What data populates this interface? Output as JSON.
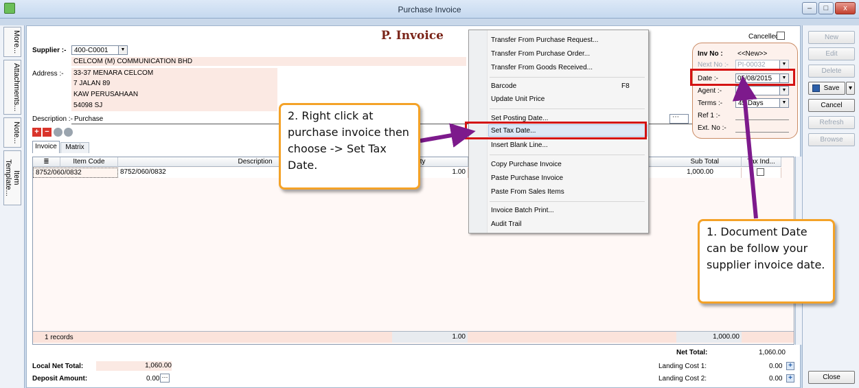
{
  "window": {
    "title": "Purchase Invoice",
    "minimize": "–",
    "maximize": "□",
    "close": "x"
  },
  "side_tabs": [
    "More...",
    "Attachments...",
    "Note...",
    "Item Template..."
  ],
  "header": {
    "heading": "P. Invoice",
    "cancelled_label": "Cancelled"
  },
  "supplier": {
    "label": "Supplier :-",
    "code": "400-C0001",
    "name": "CELCOM (M) COMMUNICATION BHD"
  },
  "address": {
    "label": "Address :-",
    "lines": [
      "33-37 MENARA CELCOM",
      "7 JALAN 89",
      "KAW PERUSAHAAN",
      "54098 SJ"
    ]
  },
  "description": {
    "label": "Description :-",
    "value": "Purchase"
  },
  "tabs": [
    "Invoice",
    "Matrix"
  ],
  "invoice_info": {
    "inv_no_label": "Inv No :",
    "inv_no": "<<New>>",
    "next_no_label": "Next No :-",
    "next_no": "PI-00032",
    "date_label": "Date :-",
    "date": "05/08/2015",
    "agent_label": "Agent :-",
    "agent": "----",
    "terms_label": "Terms :-",
    "terms": "45 Days",
    "ref1_label": "Ref 1 :-",
    "ext_no_label": "Ext. No :-"
  },
  "grid": {
    "headers": [
      "Item Code",
      "Description",
      "Qty",
      "Sub Total",
      "Tax Ind..."
    ],
    "row": {
      "item_code": "8752/060/0832",
      "description": "8752/060/0832",
      "qty": "1.00",
      "sub_total": "1,000.00"
    },
    "footer": {
      "records": "1 records",
      "qty": "1.00",
      "sub_total": "1,000.00"
    }
  },
  "totals": {
    "net_total_label": "Net Total:",
    "net_total": "1,060.00",
    "landing1_label": "Landing Cost 1:",
    "landing1": "0.00",
    "landing2_label": "Landing Cost 2:",
    "landing2": "0.00",
    "local_net_label": "Local Net Total:",
    "local_net": "1,060.00",
    "deposit_label": "Deposit Amount:",
    "deposit": "0.00"
  },
  "right_buttons": {
    "new": "New",
    "edit": "Edit",
    "delete": "Delete",
    "save": "Save",
    "cancel": "Cancel",
    "refresh": "Refresh",
    "browse": "Browse",
    "close": "Close"
  },
  "context_menu": {
    "items": [
      "Transfer From Purchase Request...",
      "Transfer From Purchase Order...",
      "Transfer From Goods Received...",
      "Barcode",
      "Update Unit Price",
      "Set Posting Date...",
      "Set Tax Date...",
      "Insert Blank Line...",
      "Copy Purchase Invoice",
      "Paste Purchase Invoice",
      "Paste From Sales Items",
      "Invoice Batch Print...",
      "Audit Trail"
    ],
    "barcode_shortcut": "F8"
  },
  "callouts": {
    "step2": "2. Right click at purchase invoice then choose -> Set Tax Date.",
    "step1": "1. Document Date can be follow your supplier invoice date."
  },
  "colors": {
    "highlight_red": "#d41212",
    "callout_border": "#f4a227",
    "arrow_purple": "#7d1a8c",
    "row_pink": "#fbe9e3"
  }
}
